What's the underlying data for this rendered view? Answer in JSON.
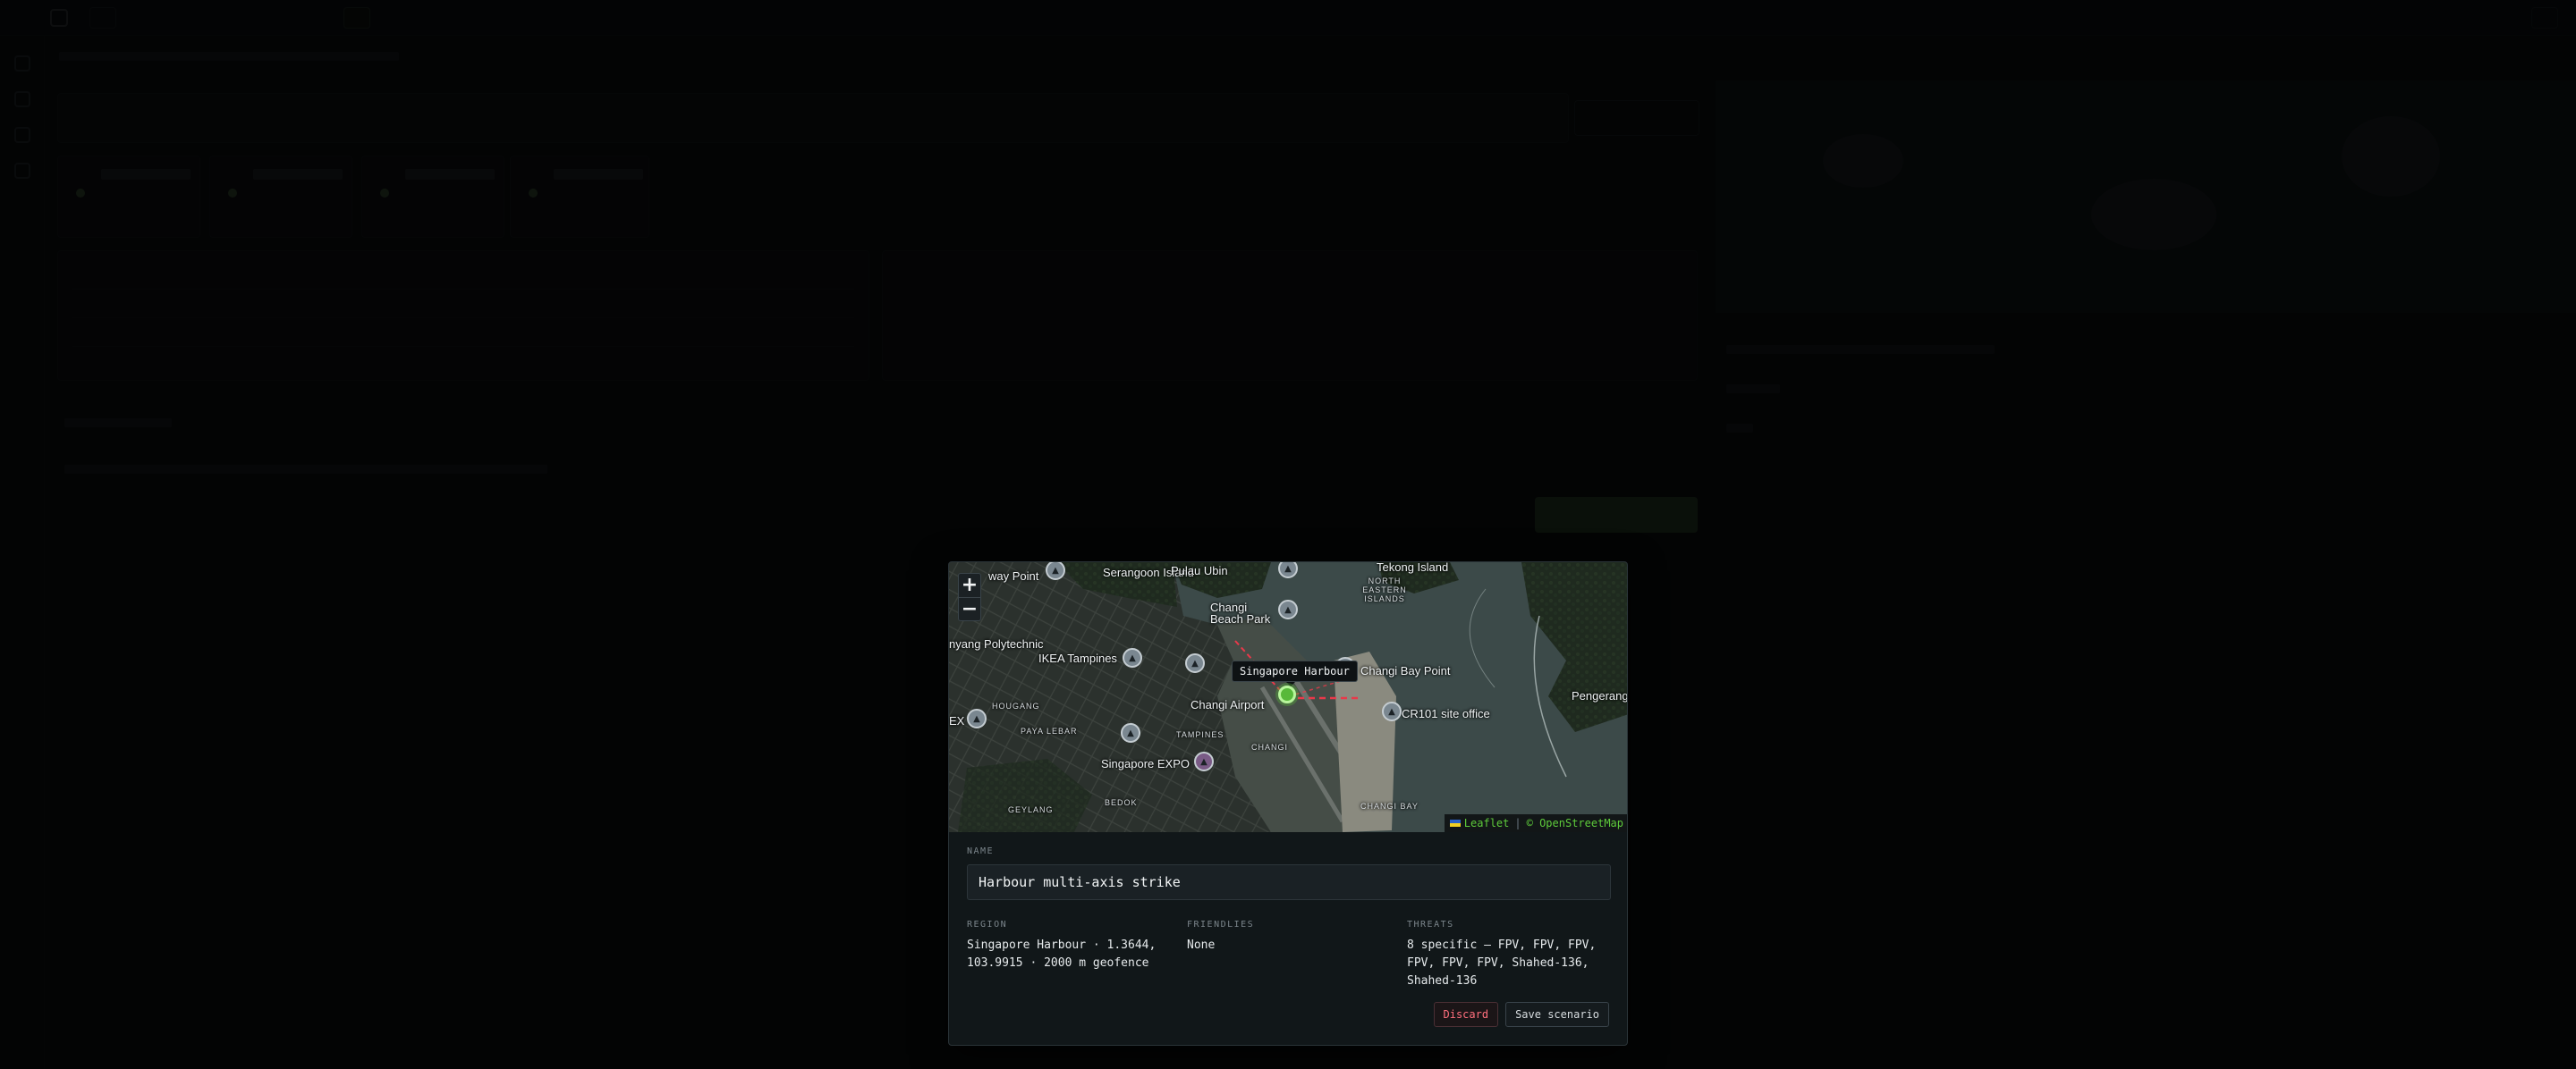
{
  "map": {
    "zoom_in": "+",
    "zoom_out": "−",
    "tooltip": "Singapore Harbour",
    "places": {
      "serangoon_island": "Serangoon Island",
      "way_point": "way Point",
      "pulau_ubin": "Pulau Ubin",
      "tekong_island": "Tekong Island",
      "north_eastern_islands": "NORTH EASTERN ISLANDS",
      "changi_beach_park": "Changi Beach Park",
      "nyang_polytechnic": "nyang Polytechnic",
      "ikea_tampines": "IKEA Tampines",
      "changi_bay_point": "Changi Bay Point",
      "changi_airport": "Changi Airport",
      "cr101_site_office": "CR101 site office",
      "pengerang": "Pengerang",
      "hougang": "HOUGANG",
      "paya_lebar": "PAYA LEBAR",
      "tampines": "TAMPINES",
      "changi": "CHANGI",
      "singapore_expo": "Singapore EXPO",
      "geylang": "GEYLANG",
      "bedok": "BEDOK",
      "changi_bay": "CHANGI BAY",
      "ex": "EX"
    },
    "attribution": {
      "leaflet": "Leaflet",
      "separator": "|",
      "osm": "OpenStreetMap"
    }
  },
  "form": {
    "name_label": "NAME",
    "name_value": "Harbour multi-axis strike",
    "region_label": "REGION",
    "region_value": "Singapore Harbour · 1.3644, 103.9915 · 2000 m geofence",
    "friendlies_label": "FRIENDLIES",
    "friendlies_value": "None",
    "threats_label": "THREATS",
    "threats_value": "8 specific — FPV, FPV, FPV, FPV, FPV, FPV, Shahed-136, Shahed-136"
  },
  "actions": {
    "discard": "Discard",
    "save": "Save scenario"
  },
  "colors": {
    "marker": "#58b93a",
    "threat_line": "#e8394a",
    "discard_text": "#ff6f7d",
    "attribution": "#5ecb3b"
  }
}
